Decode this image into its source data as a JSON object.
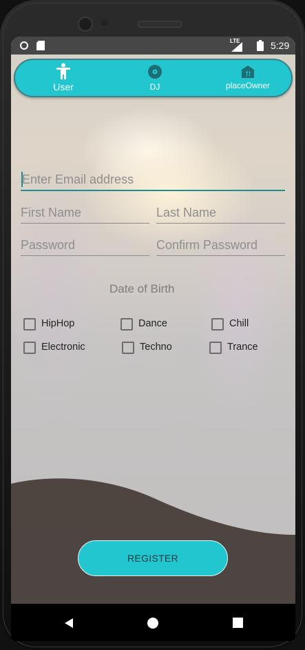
{
  "status_bar": {
    "network": "LTE",
    "time": "5:29"
  },
  "nav": {
    "tabs": [
      {
        "label": "User",
        "icon": "person-icon"
      },
      {
        "label": "DJ",
        "icon": "vinyl-disc-icon"
      },
      {
        "label": "placeOwner",
        "icon": "restaurant-icon"
      }
    ],
    "active_color": "#22c6cf"
  },
  "form": {
    "email_placeholder": "Enter Email address",
    "first_name_placeholder": "First Name",
    "last_name_placeholder": "Last Name",
    "password_placeholder": "Password",
    "confirm_password_placeholder": "Confirm Password",
    "dob_label": "Date of Birth"
  },
  "genres": [
    {
      "label": "HipHop",
      "checked": false
    },
    {
      "label": "Dance",
      "checked": false
    },
    {
      "label": "Chill",
      "checked": false
    },
    {
      "label": "Electronic",
      "checked": false
    },
    {
      "label": "Techno",
      "checked": false
    },
    {
      "label": "Trance",
      "checked": false
    }
  ],
  "register_label": "REGISTER",
  "accent_color": "#22c6cf"
}
